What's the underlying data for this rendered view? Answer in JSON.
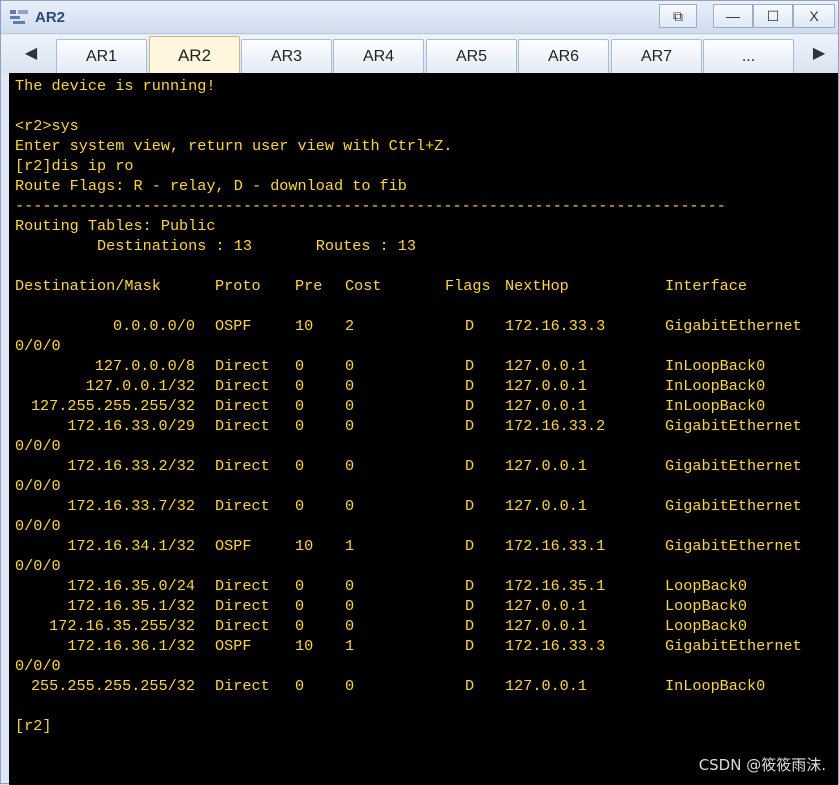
{
  "window": {
    "title": "AR2",
    "controls": {
      "restore_label": "⧉",
      "min_label": "—",
      "max_label": "☐",
      "close_label": "X"
    }
  },
  "tabs": {
    "prev_label": "◀",
    "next_label": "▶",
    "items": [
      "AR1",
      "AR2",
      "AR3",
      "AR4",
      "AR5",
      "AR6",
      "AR7",
      "..."
    ],
    "active": "AR2"
  },
  "console": {
    "intro": [
      "The device is running!",
      "",
      "<r2>sys",
      "Enter system view, return user view with Ctrl+Z.",
      "[r2]dis ip ro",
      "Route Flags: R - relay, D - download to fib",
      "------------------------------------------------------------------------------",
      "Routing Tables: Public",
      "         Destinations : 13       Routes : 13"
    ],
    "headers": [
      "Destination/Mask",
      "Proto",
      "Pre",
      "Cost",
      "Flags",
      "NextHop",
      "Interface"
    ],
    "routes": [
      {
        "dest": "0.0.0.0/0",
        "proto": "OSPF",
        "pre": "10",
        "cost": "2",
        "flags": "D",
        "nexthop": "172.16.33.3",
        "iface": "GigabitEthernet",
        "wrap": "0/0/0"
      },
      {
        "dest": "127.0.0.0/8",
        "proto": "Direct",
        "pre": "0",
        "cost": "0",
        "flags": "D",
        "nexthop": "127.0.0.1",
        "iface": "InLoopBack0",
        "wrap": ""
      },
      {
        "dest": "127.0.0.1/32",
        "proto": "Direct",
        "pre": "0",
        "cost": "0",
        "flags": "D",
        "nexthop": "127.0.0.1",
        "iface": "InLoopBack0",
        "wrap": ""
      },
      {
        "dest": "127.255.255.255/32",
        "proto": "Direct",
        "pre": "0",
        "cost": "0",
        "flags": "D",
        "nexthop": "127.0.0.1",
        "iface": "InLoopBack0",
        "wrap": ""
      },
      {
        "dest": "172.16.33.0/29",
        "proto": "Direct",
        "pre": "0",
        "cost": "0",
        "flags": "D",
        "nexthop": "172.16.33.2",
        "iface": "GigabitEthernet",
        "wrap": "0/0/0"
      },
      {
        "dest": "172.16.33.2/32",
        "proto": "Direct",
        "pre": "0",
        "cost": "0",
        "flags": "D",
        "nexthop": "127.0.0.1",
        "iface": "GigabitEthernet",
        "wrap": "0/0/0"
      },
      {
        "dest": "172.16.33.7/32",
        "proto": "Direct",
        "pre": "0",
        "cost": "0",
        "flags": "D",
        "nexthop": "127.0.0.1",
        "iface": "GigabitEthernet",
        "wrap": "0/0/0"
      },
      {
        "dest": "172.16.34.1/32",
        "proto": "OSPF",
        "pre": "10",
        "cost": "1",
        "flags": "D",
        "nexthop": "172.16.33.1",
        "iface": "GigabitEthernet",
        "wrap": "0/0/0"
      },
      {
        "dest": "172.16.35.0/24",
        "proto": "Direct",
        "pre": "0",
        "cost": "0",
        "flags": "D",
        "nexthop": "172.16.35.1",
        "iface": "LoopBack0",
        "wrap": ""
      },
      {
        "dest": "172.16.35.1/32",
        "proto": "Direct",
        "pre": "0",
        "cost": "0",
        "flags": "D",
        "nexthop": "127.0.0.1",
        "iface": "LoopBack0",
        "wrap": ""
      },
      {
        "dest": "172.16.35.255/32",
        "proto": "Direct",
        "pre": "0",
        "cost": "0",
        "flags": "D",
        "nexthop": "127.0.0.1",
        "iface": "LoopBack0",
        "wrap": ""
      },
      {
        "dest": "172.16.36.1/32",
        "proto": "OSPF",
        "pre": "10",
        "cost": "1",
        "flags": "D",
        "nexthop": "172.16.33.3",
        "iface": "GigabitEthernet",
        "wrap": "0/0/0"
      },
      {
        "dest": "255.255.255.255/32",
        "proto": "Direct",
        "pre": "0",
        "cost": "0",
        "flags": "D",
        "nexthop": "127.0.0.1",
        "iface": "InLoopBack0",
        "wrap": ""
      }
    ],
    "prompt": "[r2]"
  },
  "watermark": "CSDN @筱筱雨沫.",
  "colors": {
    "terminal_text": "#ffd91c",
    "terminal_bg": "#000000"
  }
}
